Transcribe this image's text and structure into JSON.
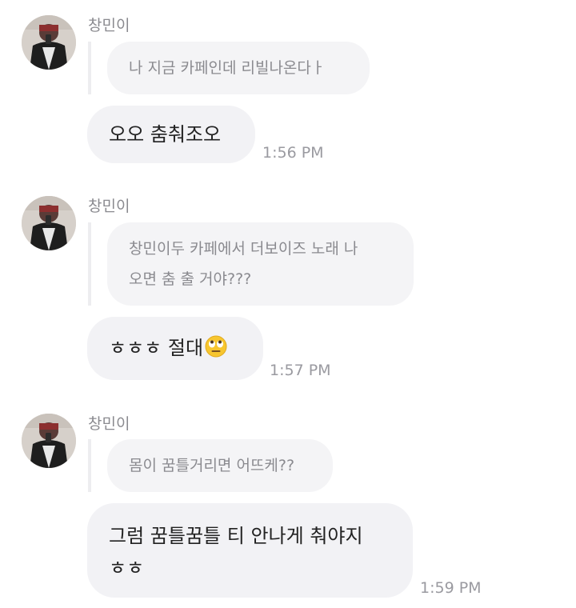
{
  "messages": [
    {
      "sender": "창민이",
      "quote": "나 지금 카페인데 리빌나온다ㅏ",
      "reply": "오오 춤춰조오",
      "time": "1:56 PM"
    },
    {
      "sender": "창민이",
      "quote": "창민이두 카페에서 더보이즈 노래 나\n오면 춤 출 거야???",
      "reply": "ㅎㅎㅎ 절대",
      "reply_emoji": "eye-roll-emoji-icon",
      "time": "1:57 PM"
    },
    {
      "sender": "창민이",
      "quote": "몸이 꿈틀거리면 어뜨케??",
      "reply": "그럼 꿈틀꿈틀 티 안나게 춰야지\nㅎㅎ",
      "time": "1:59 PM"
    }
  ],
  "colors": {
    "bubble": "#f2f2f5",
    "quote_bubble": "#f4f4f6",
    "secondary_text": "#8a8a8f",
    "primary_text": "#222222"
  }
}
